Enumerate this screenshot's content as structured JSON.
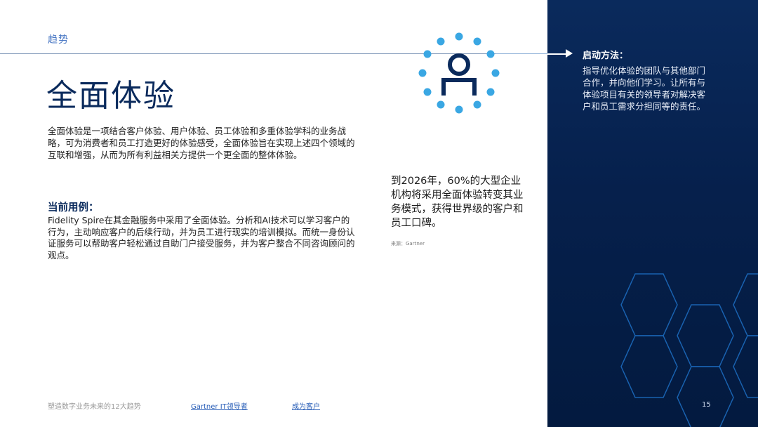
{
  "header": {
    "section_label": "趋势",
    "title": "全面体验"
  },
  "intro": {
    "text": "全面体验是一项结合客户体验、用户体验、员工体验和多重体验学科的业务战略，可为消费者和员工打造更好的体验感受，全面体验旨在实现上述四个领域的互联和增强，从而为所有利益相关方提供一个更全面的整体体验。"
  },
  "use_case": {
    "heading": "当前用例：",
    "text": "Fidelity Spire在其金融服务中采用了全面体验。分析和AI技术可以学习客户的行为，主动响应客户的后续行动，并为员工进行现实的培训模拟。而统一身份认证服务可以帮助客户轻松通过自助门户接受服务，并为客户整合不同咨询顾问的观点。"
  },
  "stat": {
    "text": "到2026年，60%的大型企业机构将采用全面体验转变其业务模式，获得世界级的客户和员工口碑。",
    "source": "来源：Gartner"
  },
  "approach": {
    "title": "启动方法：",
    "text": "指导优化体验的团队与其他部门合作，并向他们学习。让所有与体验项目有关的领导者对解决客户和员工需求分担同等的责任。"
  },
  "footer": {
    "left_text": "塑造数字业务未来的12大趋势",
    "link1": "Gartner IT领导者",
    "link2": "成为客户",
    "page_number": "15"
  },
  "icons": {
    "person": "person-icon",
    "arrow": "arrow-right-icon"
  },
  "colors": {
    "navy": "#0a2a5c",
    "accent_blue": "#3aa7e3",
    "label_blue": "#4a78c4",
    "panel_bg": "#06204c",
    "hex_stroke": "#1d6fc4"
  }
}
